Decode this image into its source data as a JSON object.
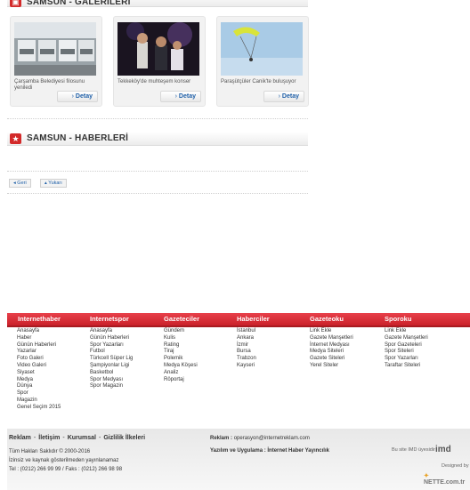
{
  "gallery_section": {
    "title": "SAMSUN - GALERİLERİ"
  },
  "gallery": [
    {
      "caption": "Çarşamba Belediyesi filosunu yeniledi",
      "detay": "Detay"
    },
    {
      "caption": "Tekkeköy'de muhteşem konser",
      "detay": "Detay"
    },
    {
      "caption": "Paraşütçüler Canik'te buluşuyor",
      "detay": "Detay"
    }
  ],
  "news_section": {
    "title": "SAMSUN - HABERLERİ"
  },
  "pager": {
    "back": "Geri",
    "up": "Yukarı"
  },
  "footer": {
    "columns": [
      {
        "title": "Internethaber",
        "items": [
          "Anasayfa",
          "Haber",
          "Günün Haberleri",
          "Yazarlar",
          "Foto Galeri",
          "Video Galeri",
          "Siyaset",
          "Medya",
          "Dünya",
          "Spor",
          "Magazin",
          "Genel Seçim 2015"
        ]
      },
      {
        "title": "Internetspor",
        "items": [
          "Anasayfa",
          "Günün Haberleri",
          "Spor Yazarları",
          "Futbol",
          "Türkcell Süper Lig",
          "Şampiyonlar Ligi",
          "Basketbol",
          "Spor Medyası",
          "Spor Magazin"
        ]
      },
      {
        "title": "Gazeteciler",
        "items": [
          "Gündem",
          "Kulis",
          "Rating",
          "Tiraj",
          "Polemik",
          "Medya Köşesi",
          "Analiz",
          "Röportaj"
        ]
      },
      {
        "title": "Haberciler",
        "items": [
          "İstanbul",
          "Ankara",
          "İzmir",
          "Bursa",
          "Trabzon",
          "Kayseri"
        ]
      },
      {
        "title": "Gazeteoku",
        "items": [
          "Link Ekle",
          "Gazete Manşetleri",
          "İnternet Medyası",
          "Medya Siteleri",
          "Gazete Siteleri",
          "Yerel Siteler"
        ]
      },
      {
        "title": "Sporoku",
        "items": [
          "Link Ekle",
          "Gazete Manşetleri",
          "Spor Gazeteleri",
          "Spor Siteleri",
          "Spor Yazarları",
          "Taraftar Siteleri"
        ]
      }
    ],
    "links": {
      "reklam": "Reklam",
      "iletisim": "İletişim",
      "kurumsal": "Kurumsal",
      "gizlilik": "Gizlilik İlkeleri"
    },
    "copyright": "Tüm Hakları Saklıdır © 2000-2016",
    "izinsiz": "İzinsiz ve kaynak gösterilmeden yayınlanamaz",
    "tel": "Tel : (0212) 266 99 99 / Faks : (0212) 266 98 98",
    "reklam_label": "Reklam :",
    "reklam_email": "operasyon@internetreklam.com",
    "yazilim": "Yazılım ve Uygulama : İnternet Haber Yayıncılık",
    "imd_text": "Bu site IMD üyesidir",
    "imd_logo": "imd",
    "designed_by": "Designed by",
    "nette": "NETTE.com.tr"
  }
}
